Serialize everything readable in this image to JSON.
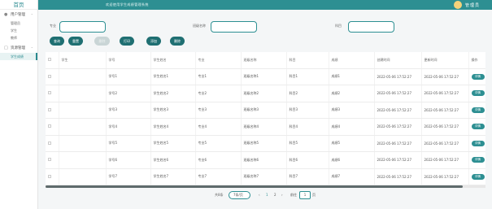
{
  "sidebar": {
    "home": "首页",
    "groups": [
      {
        "label": "用户管理",
        "items": [
          "管理员",
          "学生",
          "教师"
        ]
      },
      {
        "label": "资源管理",
        "items": [
          "学生成绩"
        ]
      }
    ]
  },
  "header": {
    "title": "欢迎使用学生成绩管理系统",
    "username": "管理员"
  },
  "search": {
    "field1_label": "专业",
    "field2_label": "班级名称",
    "field3_label": "科目"
  },
  "toolbar": {
    "search": "查询",
    "reset": "重置",
    "disabled": "删除",
    "print": "打印",
    "add": "添加",
    "remove": "删除"
  },
  "table": {
    "columns": [
      "学生",
      "学号",
      "学生姓名",
      "专业",
      "班级名称",
      "科目",
      "成绩",
      "创建时间",
      "更新时间",
      "操作"
    ],
    "rows": [
      [
        "学号1",
        "学生姓名1",
        "专业1",
        "班级名称1",
        "科目1",
        "成绩1",
        "2022-05-06 17:52:27",
        "2022-05-06 17:52:27"
      ],
      [
        "学号2",
        "学生姓名2",
        "专业2",
        "班级名称2",
        "科目2",
        "成绩2",
        "2022-05-06 17:52:27",
        "2022-05-06 17:52:27"
      ],
      [
        "学号3",
        "学生姓名3",
        "专业3",
        "班级名称3",
        "科目3",
        "成绩3",
        "2022-05-06 17:52:27",
        "2022-05-06 17:52:27"
      ],
      [
        "学号4",
        "学生姓名4",
        "专业4",
        "班级名称4",
        "科目4",
        "成绩4",
        "2022-05-06 17:52:27",
        "2022-05-06 17:52:27"
      ],
      [
        "学号5",
        "学生姓名5",
        "专业5",
        "班级名称5",
        "科目5",
        "成绩5",
        "2022-05-06 17:52:27",
        "2022-05-06 17:52:27"
      ],
      [
        "学号6",
        "学生姓名6",
        "专业6",
        "班级名称6",
        "科目6",
        "成绩6",
        "2022-05-06 17:52:27",
        "2022-05-06 17:52:27"
      ],
      [
        "学号7",
        "学生姓名7",
        "专业7",
        "班级名称7",
        "科目7",
        "成绩7",
        "2022-05-06 17:52:27",
        "2022-05-06 17:52:27"
      ]
    ],
    "row_action": "详情"
  },
  "pagination": {
    "total": "共8条",
    "per_page": "7条/页",
    "pages": [
      "1",
      "2"
    ],
    "goto_label": "前往",
    "goto_value": "1",
    "goto_suffix": "页"
  },
  "colors": {
    "accent": "#2d8f92",
    "button": "#1f6f72"
  }
}
